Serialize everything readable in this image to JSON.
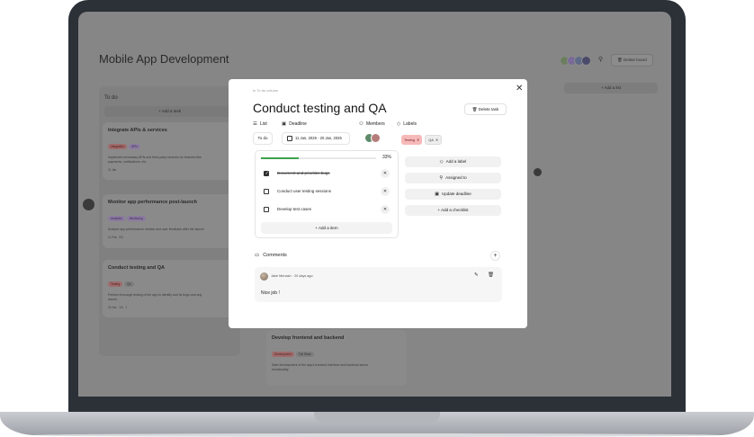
{
  "background": {
    "app_title": "Mobile App Development",
    "header_delete_label": "Delete board",
    "header_assign_icon": "user-assign-icon",
    "column_title": "To do",
    "add_task_label": "+ Add a task",
    "add_list_label": "+ Add a list",
    "cards": [
      {
        "title": "Integrate APIs & services",
        "chips": [
          "Integration",
          "APIs"
        ],
        "desc": "Implement necessary APIs and third-party services for features like",
        "desc2": "payments, notifications, etc.",
        "meta": "11 Jan"
      },
      {
        "title": "Monitor app performance post-launch",
        "chips": [
          "Analytics",
          "Monitoring"
        ],
        "desc": "Analyze app performance metrics and user feedback after the launch",
        "desc2": "",
        "meta1": "11 Feb",
        "meta2": "0/3"
      },
      {
        "title": "Conduct testing and QA",
        "chips": [
          "Testing",
          "QA"
        ],
        "desc": "Perform thorough testing of the app to identify and fix bugs and any",
        "desc2": "issues.",
        "meta1": "20 Jan",
        "meta2": "1/3",
        "meta3": "1"
      },
      {
        "title": "Develop frontend and backend",
        "chips": [
          "Development",
          "Full Stack"
        ],
        "desc": "Start development of the app's frontend interface and backend server",
        "desc2": "functionality."
      }
    ]
  },
  "modal": {
    "breadcrumb": "In To do column",
    "title": "Conduct testing and QA",
    "delete_task_label": "Delete task",
    "list_label": "List",
    "list_value": "To do",
    "deadline_label": "Deadline",
    "deadline_value": "11 Jan, 2025 - 20 Jan, 2025",
    "members_label": "Members",
    "labels_label": "Labels",
    "labels": [
      {
        "text": "Testing",
        "color": "#f6b9b9"
      },
      {
        "text": "QA",
        "color": "#eeeeee"
      }
    ],
    "checklist": {
      "progress": 0.33,
      "progress_text": "33%",
      "items": [
        {
          "text": "Document and prioritize bugs",
          "done": true
        },
        {
          "text": "Conduct user testing sessions",
          "done": false
        },
        {
          "text": "Develop test cases",
          "done": false
        }
      ],
      "add_item_label": "+ Add a item"
    },
    "actions": {
      "add_label": "Add a label",
      "assigned_to": "Assigned to",
      "update_deadline": "Update deadline",
      "add_checklist": "+ Add a checklist"
    },
    "comments": {
      "label": "Comments",
      "items": [
        {
          "author_line": "Jake Menash · 20 days ago",
          "text": "Nice job !"
        }
      ]
    }
  },
  "colors": {
    "accent_green": "#3fa24a",
    "testing_label": "#f6b9b9",
    "overlay": "#868686"
  }
}
